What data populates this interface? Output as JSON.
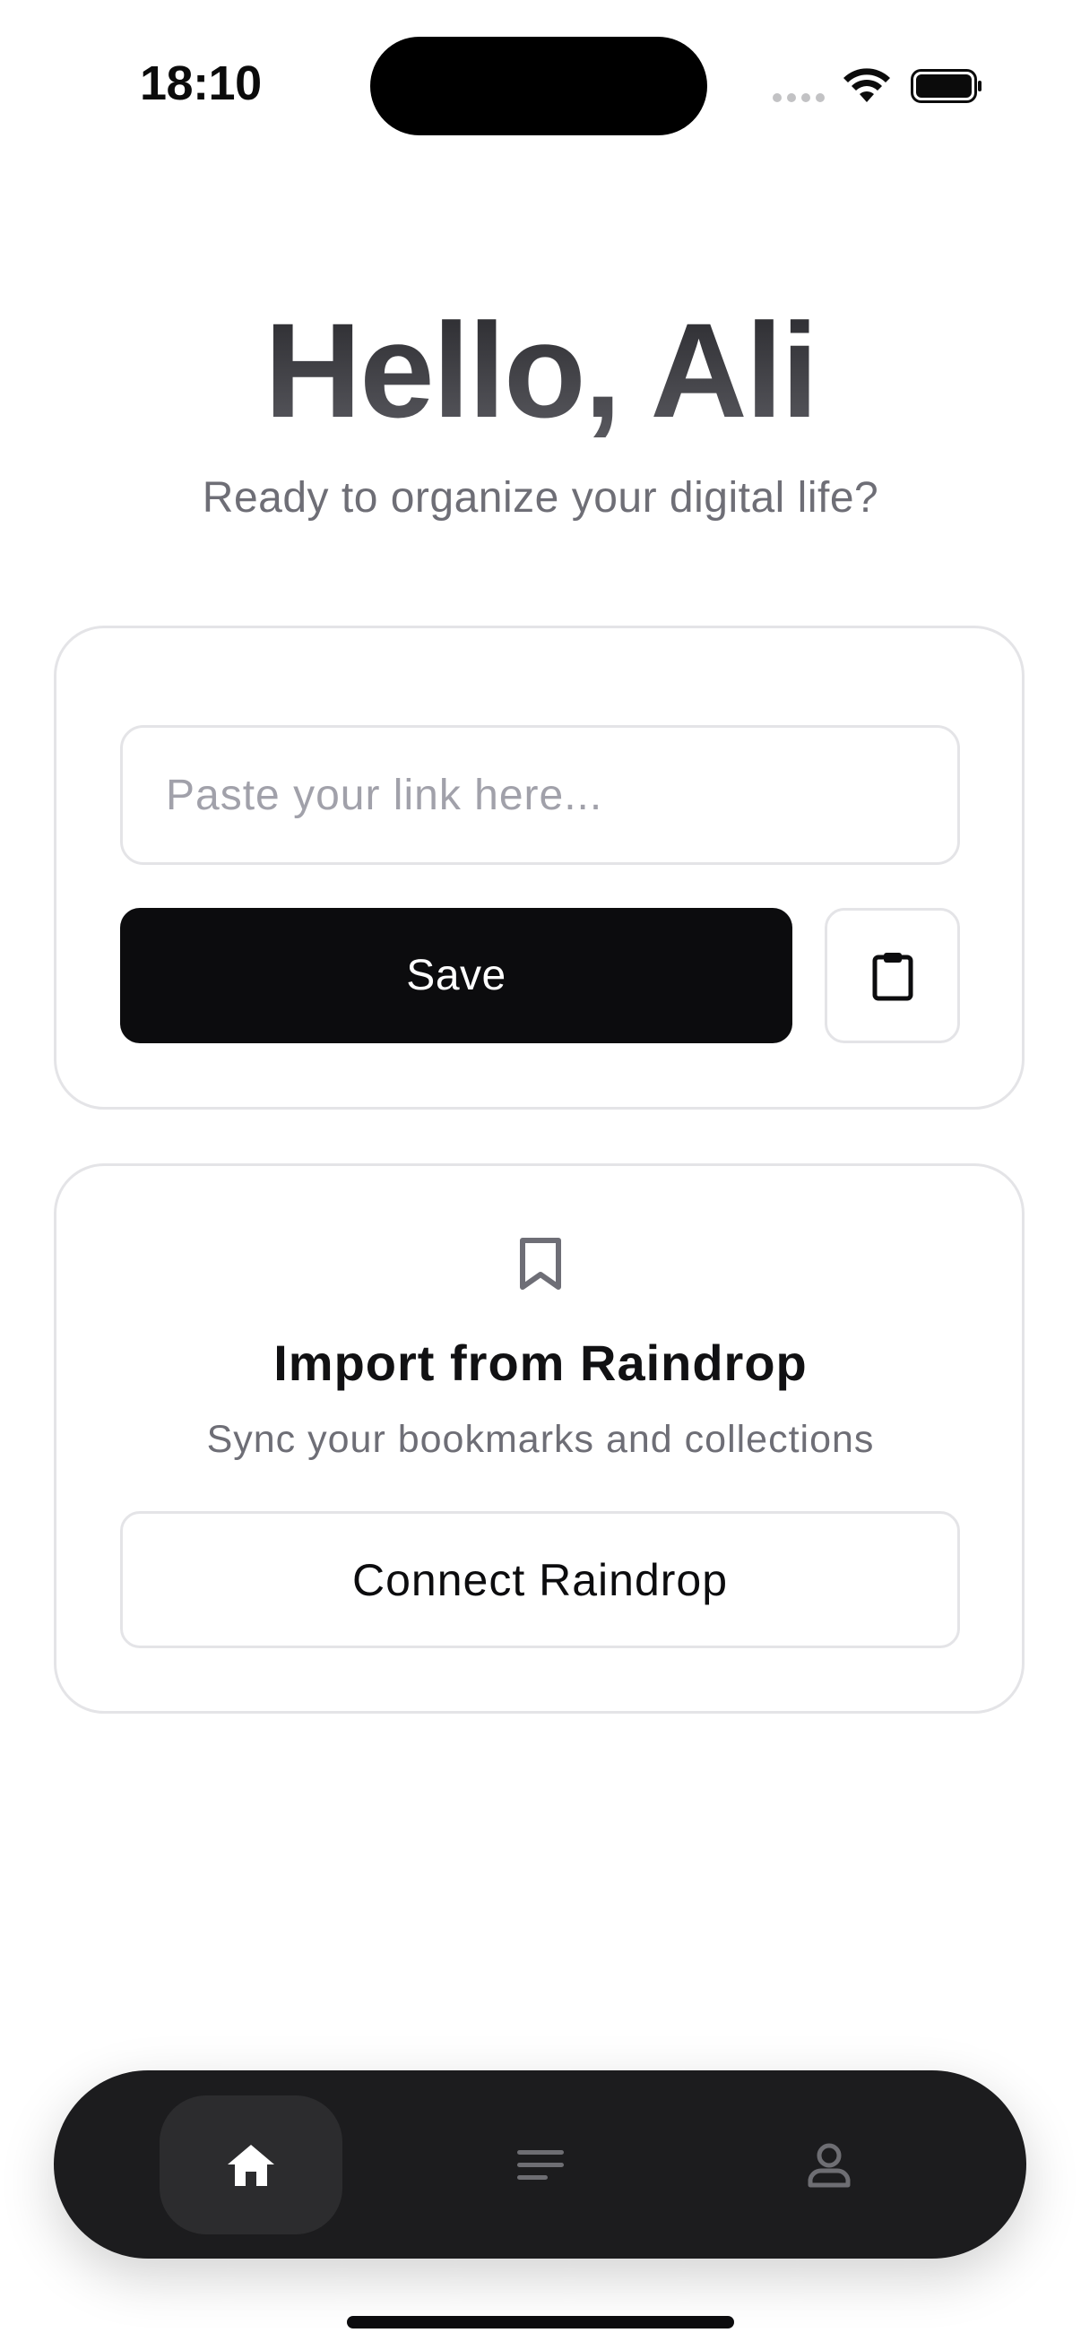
{
  "status_bar": {
    "time": "18:10"
  },
  "header": {
    "greeting": "Hello, Ali",
    "subtitle": "Ready to organize your digital life?"
  },
  "save_card": {
    "link_placeholder": "Paste your link here...",
    "link_value": "",
    "save_label": "Save",
    "paste_icon": "clipboard-icon"
  },
  "import_card": {
    "icon": "bookmark-icon",
    "title": "Import from Raindrop",
    "description": "Sync your bookmarks and collections",
    "connect_label": "Connect Raindrop"
  },
  "tab_bar": {
    "tabs": [
      {
        "id": "home",
        "icon": "home-icon",
        "active": true
      },
      {
        "id": "list",
        "icon": "list-icon",
        "active": false
      },
      {
        "id": "profile",
        "icon": "profile-icon",
        "active": false
      }
    ]
  },
  "colors": {
    "primary": "#0c0c0e",
    "border": "#e4e4e7",
    "muted_text": "#6e6e76",
    "tab_bar_bg": "#1c1c1e",
    "tab_active_bg": "#2c2c2e"
  }
}
